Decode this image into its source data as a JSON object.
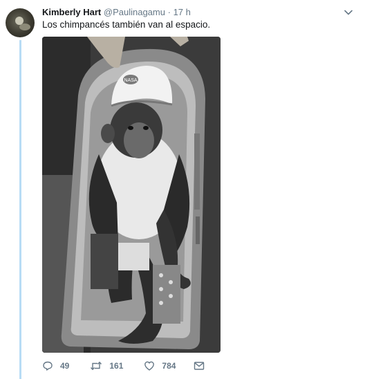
{
  "tweet": {
    "author_name": "Kimberly Hart",
    "handle": "@Paulinagamu",
    "separator": "·",
    "time": "17 h",
    "text": "Los chimpancés también van al espacio.",
    "helmet_text": "NASA"
  },
  "actions": {
    "replies": "49",
    "retweets": "161",
    "likes": "784"
  },
  "colors": {
    "thread_line": "#b8dcf5",
    "secondary_text": "#657786"
  },
  "icons": [
    "chevron-down-icon",
    "reply-icon",
    "retweet-icon",
    "like-icon",
    "message-icon"
  ]
}
